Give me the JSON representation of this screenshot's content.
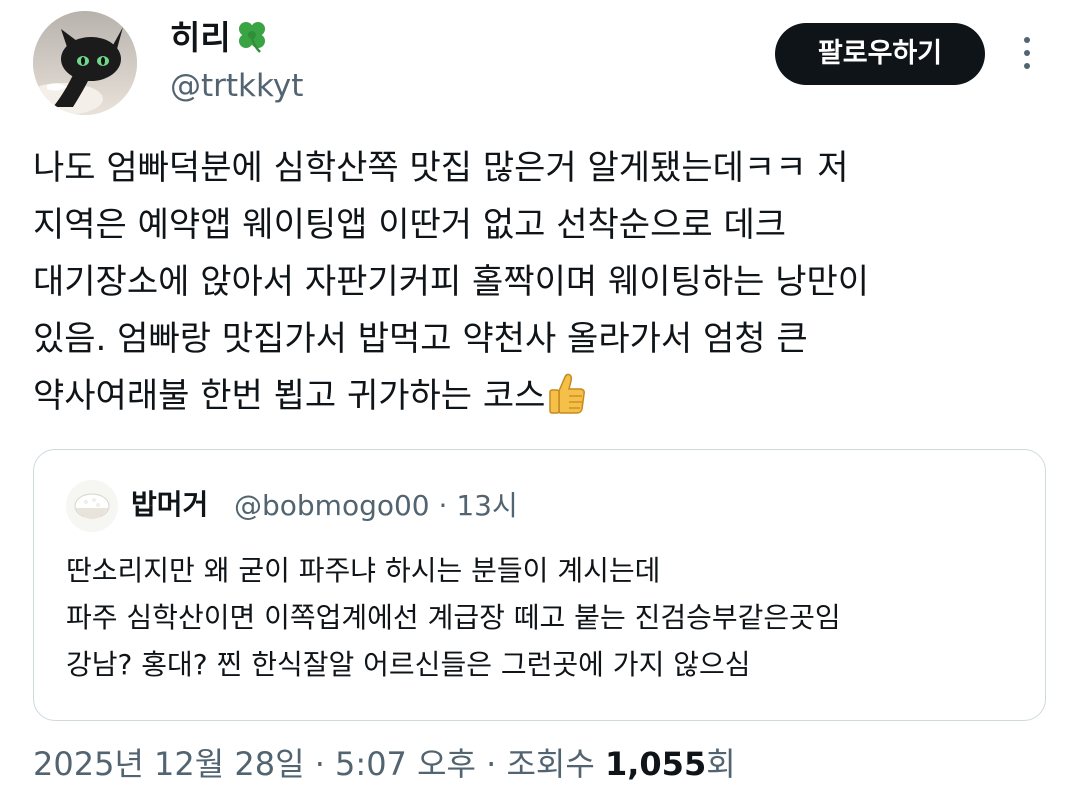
{
  "author": {
    "display_name": "히리",
    "name_badge_icon": "four-leaf-clover-icon",
    "handle": "@trtkkyt",
    "avatar_icon": "black-cat-dragon-avatar"
  },
  "actions": {
    "follow_label": "팔로우하기",
    "more_icon": "vertical-ellipsis-icon"
  },
  "tweet": {
    "lines": [
      "나도 엄빠덕분에 심학산쪽 맛집 많은거 알게됐는데ㅋㅋ 저",
      "지역은 예약앱 웨이팅앱 이딴거 없고 선착순으로 데크",
      "대기장소에 앉아서 자판기커피 홀짝이며 웨이팅하는 낭만이",
      "있음. 엄빠랑 맛집가서 밥먹고 약천사 올라가서 엄청 큰",
      "약사여래불 한번 뵙고 귀가하는 코스"
    ],
    "trailing_emoji_icon": "thumbs-up-icon"
  },
  "quote": {
    "avatar_icon": "rice-bowl-avatar",
    "name": "밥머거",
    "handle_time": "@bobmogo00 · 13시",
    "lines": [
      "딴소리지만 왜 굳이 파주냐 하시는 분들이 계시는데",
      "파주 심학산이면 이쪽업계에선 계급장 떼고 붙는 진검승부같은곳임",
      "강남? 홍대? 찐 한식잘알 어르신들은 그런곳에 가지 않으심"
    ]
  },
  "meta": {
    "timestamp": "2025년 12월 28일 · 5:07 오후 · 조회수 ",
    "views_count": "1,055",
    "views_suffix": "회"
  },
  "colors": {
    "text": "#0f1419",
    "secondary": "#536471",
    "border": "#cfd9de",
    "button_bg": "#0f1419"
  }
}
